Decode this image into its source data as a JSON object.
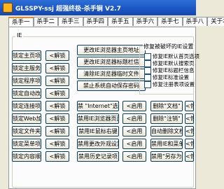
{
  "window": {
    "title": "GLSSPY-ssj 超强终极-杀手锏 V2.7"
  },
  "tabs": [
    "杀手一",
    "杀手二",
    "杀手三",
    "杀手四",
    "杀手五",
    "杀手六",
    "杀手七",
    "杀手八",
    "关于本"
  ],
  "group_label": "IE",
  "col1": [
    "锁定主页项",
    "锁定主服务",
    "锁定程序项",
    "锁定自动改",
    "锁定连接项",
    "锁定Web加",
    "锁定文件夹",
    "锁定菜单项",
    "锁定内容顺"
  ],
  "col2": [
    "<解锁",
    "<解锁",
    "<解锁",
    "<解锁",
    "<解锁",
    "<解锁",
    "<解锁",
    "<解锁",
    "<解锁"
  ],
  "wide_top": [
    "更改IE浏览器主页地址",
    "更改IE浏览器标题栏信",
    "清除IE浏览器临时文件",
    "禁止系统自动保存密码"
  ],
  "col3": [
    "禁 \"Internet\"选项",
    "禁用IE浏览器页面",
    "禁用IE鼠标右键",
    "禁用更改外观设置",
    "禁用历史记录项"
  ],
  "col4": [
    "<启用",
    "<启用",
    "<启用",
    "<启用",
    "<启用"
  ],
  "col5": [
    "删除\"文档\"",
    "删除\"注销\"",
    "自动删除文档",
    "禁用IE和菜单",
    "禁用\"另存为\""
  ],
  "col6": [
    "<恢",
    "<恢",
    "<恢",
    "<恢",
    "<恢"
  ],
  "settings_box": {
    "label": "修复被破坏的IE设置",
    "options": [
      "修复IE默认首页选项",
      "修复IE默认搜索页",
      "修复IE标题栏信息",
      "修复IE标准设置",
      "修复注册表项设置"
    ]
  }
}
